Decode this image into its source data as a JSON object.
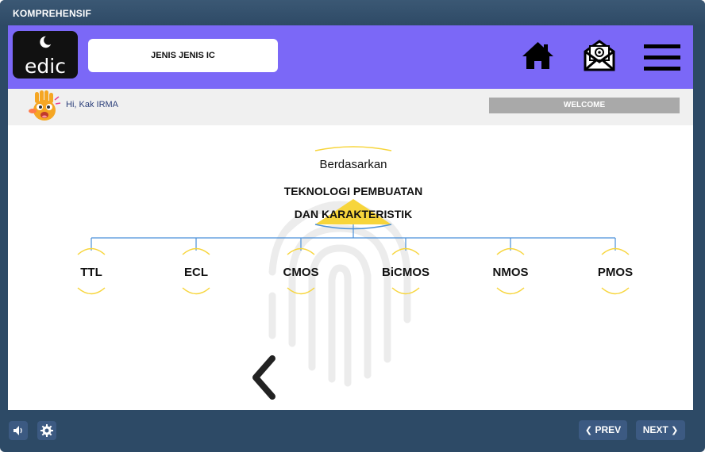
{
  "window": {
    "title": "KOMPREHENSIF"
  },
  "header": {
    "logo_text": "edic",
    "topic_title": "JENIS JENIS IC",
    "icons": [
      "home-icon",
      "mail-icon",
      "menu-icon"
    ]
  },
  "greeting": {
    "text": "Hi, Kak IRMA",
    "welcome_label": "WELCOME"
  },
  "diagram": {
    "intro": "Berdasarkan",
    "main_line1": "TEKNOLOGI PEMBUATAN",
    "main_line2": "DAN KARAKTERISTIK",
    "nodes": [
      "TTL",
      "ECL",
      "CMOS",
      "BiCMOS",
      "NMOS",
      "PMOS"
    ]
  },
  "controls": {
    "prev_label": "PREV",
    "next_label": "NEXT",
    "icons": [
      "speaker-icon",
      "settings-icon",
      "back-arrow-icon"
    ]
  },
  "colors": {
    "header_bg": "#7b68f7",
    "frame_bg": "#2d4a66",
    "accent_yellow": "#f7d53b",
    "connector_blue": "#4a90d9",
    "button_bg": "#3c5a82"
  }
}
